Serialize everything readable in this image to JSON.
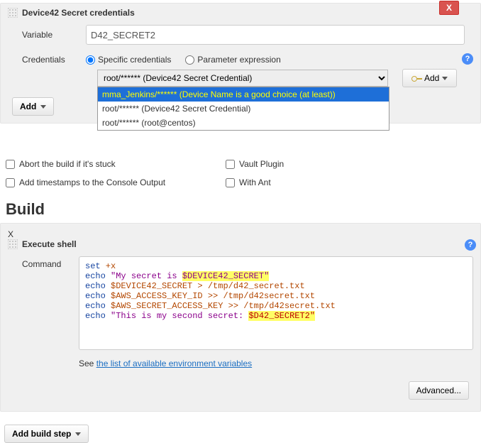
{
  "section1": {
    "title": "Device42 Secret credentials",
    "close_label": "X",
    "variable_label": "Variable",
    "variable_value": "D42_SECRET2",
    "credentials_label": "Credentials",
    "radio_specific": "Specific credentials",
    "radio_param": "Parameter expression",
    "selected_option": "root/****** (Device42 Secret Credential)",
    "dropdown_options": [
      "mma_Jenkins/****** (Device Name is a good choice (at least))",
      "root/****** (Device42 Secret Credential)",
      "root/****** (root@centos)"
    ],
    "add_cred_btn": "Add",
    "add_dd_btn": "Add"
  },
  "checkboxes": {
    "abort": "Abort the build if it's stuck",
    "vault": "Vault Plugin",
    "timestamps": "Add timestamps to the Console Output",
    "withant": "With Ant"
  },
  "build_heading": "Build",
  "exec": {
    "title": "Execute shell",
    "close_label": "X",
    "command_label": "Command",
    "see_prefix": "See ",
    "see_link": "the list of available environment variables",
    "advanced_btn": "Advanced..."
  },
  "add_build_step_btn": "Add build step",
  "cmd": {
    "line1_a": "set",
    "line1_b": " +x",
    "line2_a": "echo",
    "line2_b": " \"My secret is ",
    "line2_c": "$DEVICE42_SECRET\"",
    "line3_a": "echo",
    "line3_b": " $DEVICE42_SECRET > /tmp/d42_secret.txt",
    "line4_a": "echo",
    "line4_b": " $AWS_ACCESS_KEY_ID >> /tmp/d42secret.txt",
    "line5_a": "echo",
    "line5_b": " $AWS_SECRET_ACCESS_KEY >> /tmp/d42secret.txt",
    "line6_a": "echo",
    "line6_b": " \"This is my second secret: ",
    "line6_c": "$D42_SECRET2\""
  }
}
